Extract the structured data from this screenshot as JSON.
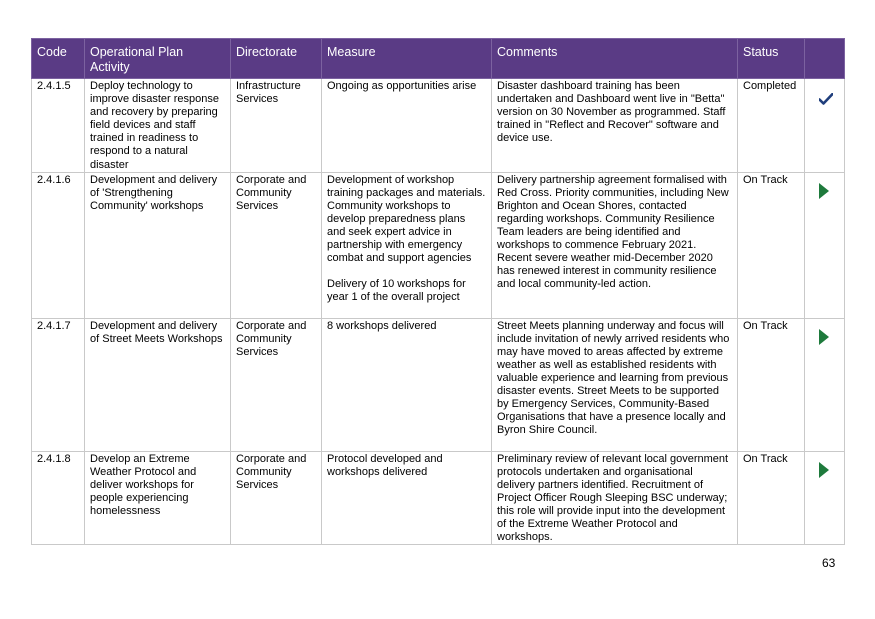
{
  "table": {
    "headers": [
      "Code",
      "Operational Plan Activity",
      "Directorate",
      "Measure",
      "Comments",
      "Status",
      ""
    ],
    "rows": [
      {
        "code": "2.4.1.5",
        "activity": "Deploy technology to improve disaster response and recovery by preparing field devices and staff trained in readiness to respond to a natural disaster",
        "directorate": "Infrastructure Services",
        "measure": "Ongoing as opportunities arise",
        "measure_extra": "",
        "comments": "Disaster dashboard training has been undertaken and Dashboard went live in \"Betta\" version on 30 November as programmed. Staff trained in \"Reflect and Recover\" software and device use.",
        "status": "Completed",
        "status_icon": "check-icon"
      },
      {
        "code": "2.4.1.6",
        "activity": "Development and delivery of 'Strengthening Community' workshops",
        "directorate": "Corporate and Community Services",
        "measure": "Development of workshop training packages and materials. Community workshops to develop preparedness plans and seek expert advice in partnership with emergency combat and support agencies",
        "measure_extra": "Delivery of 10 workshops for year 1 of the overall project",
        "comments": "Delivery partnership agreement formalised with Red Cross.  Priority communities, including New Brighton and Ocean Shores, contacted regarding workshops. Community Resilience Team leaders are being identified and workshops to commence February 2021. Recent severe weather mid-December 2020 has renewed interest in community resilience and local community-led action.",
        "status": "On Track",
        "status_icon": "arrow-right-icon"
      },
      {
        "code": "2.4.1.7",
        "activity": "Development and delivery of Street Meets Workshops",
        "directorate": "Corporate and Community Services",
        "measure": "8 workshops delivered",
        "measure_extra": "",
        "comments": "Street Meets planning underway and focus will include invitation of newly arrived residents who may have moved to areas affected by extreme weather as well as established residents with valuable experience and learning from previous disaster events. Street Meets to be supported by Emergency Services, Community-Based Organisations that have a presence locally and Byron Shire Council.",
        "status": "On Track",
        "status_icon": "arrow-right-icon"
      },
      {
        "code": "2.4.1.8",
        "activity": "Develop an Extreme Weather Protocol and deliver workshops for people experiencing homelessness",
        "directorate": "Corporate and Community Services",
        "measure": "Protocol developed and workshops delivered",
        "measure_extra": "",
        "comments": "Preliminary review of relevant local government protocols undertaken and organisational delivery partners identified. Recruitment of Project Officer Rough Sleeping BSC underway; this role will provide input into the development of the Extreme Weather Protocol and workshops.",
        "status": "On Track",
        "status_icon": "arrow-right-icon"
      }
    ]
  },
  "page_number": "63",
  "colors": {
    "header_bg": "#5a3b85",
    "header_text": "#ffffff",
    "check": "#1f3e7c",
    "arrow": "#1e7a3c",
    "border": "#c9c9c9"
  }
}
